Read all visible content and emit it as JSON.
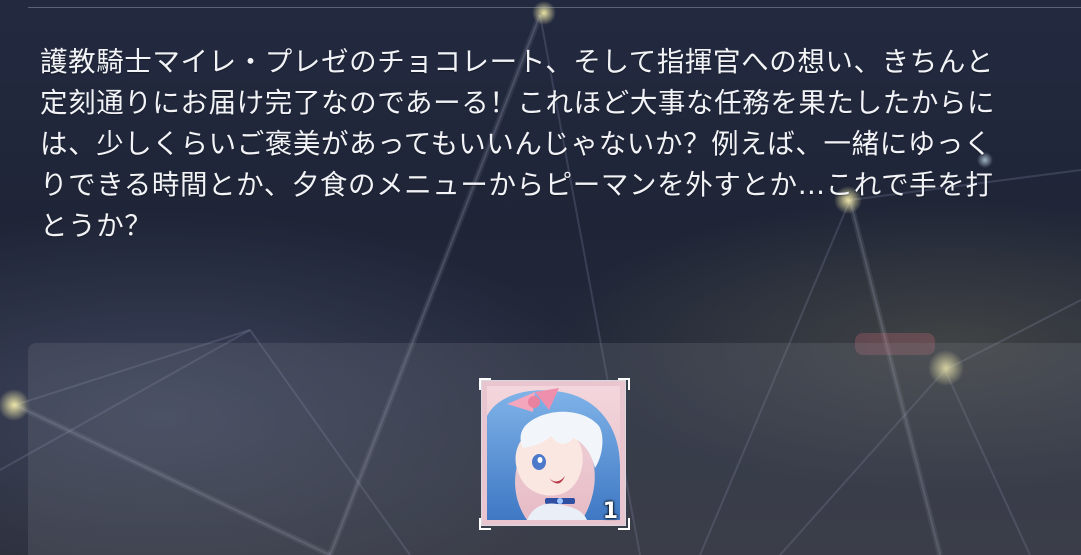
{
  "message": {
    "lines": [
      "護教騎士マイレ・プレゼのチョコレート、そして指揮官への想い、きちんと",
      "定刻通りにお届け完了なのであーる！これほど大事な任務を果たしたからに",
      "は、少しくらいご褒美があってもいいんじゃないか？例えば、一緒にゆっく",
      "りできる時間とか、夕食のメニューからピーマンを外すとか…これで手を打",
      "とうか？"
    ]
  },
  "reward": {
    "icon": "character-portrait-icon",
    "count": "1"
  },
  "colors": {
    "text": "#f2f3f6",
    "panel": "#80848e",
    "frame": "#e9c6cf"
  }
}
